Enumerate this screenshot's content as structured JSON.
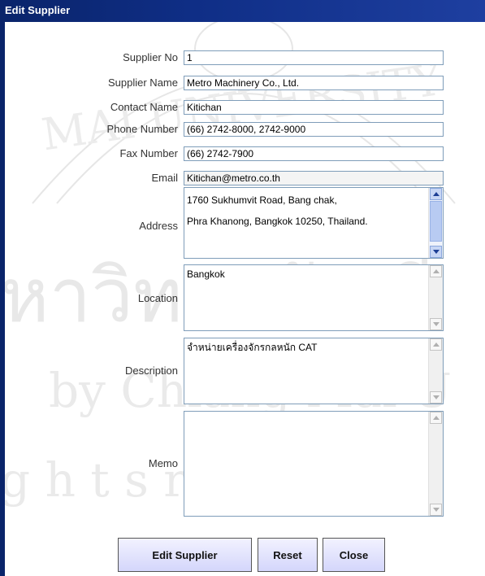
{
  "window": {
    "title": "Edit Supplier"
  },
  "form": {
    "supplier_no": {
      "label": "Supplier No",
      "value": "1"
    },
    "supplier_name": {
      "label": "Supplier Name",
      "value": "Metro Machinery Co., Ltd."
    },
    "contact_name": {
      "label": "Contact Name",
      "value": "Kitichan"
    },
    "phone_number": {
      "label": "Phone Number",
      "value": "(66) 2742-8000, 2742-9000"
    },
    "fax_number": {
      "label": "Fax Number",
      "value": "(66) 2742-7900"
    },
    "email": {
      "label": "Email",
      "value": "Kitichan@metro.co.th"
    },
    "address": {
      "label": "Address",
      "line1": "1760 Sukhumvit Road, Bang chak,",
      "line2": "Phra Khanong, Bangkok 10250, Thailand."
    },
    "location": {
      "label": "Location",
      "value": "Bangkok"
    },
    "description": {
      "label": "Description",
      "value": "จำหน่ายเครื่องจักรกลหนัก CAT"
    },
    "memo": {
      "label": "Memo",
      "value": ""
    }
  },
  "buttons": {
    "edit_supplier": "Edit Supplier",
    "reset": "Reset",
    "close": "Close"
  },
  "watermark": {
    "line1": "by Chiang Mai U",
    "line2": "g h t s   r e s e",
    "thai": "หาวิทยาลัยเชี",
    "arc": "MAI UNIVERSITY"
  },
  "colors": {
    "titlebar": "#0a246a",
    "button_bg": "#d4d6fb",
    "field_border": "#7f9db9"
  }
}
